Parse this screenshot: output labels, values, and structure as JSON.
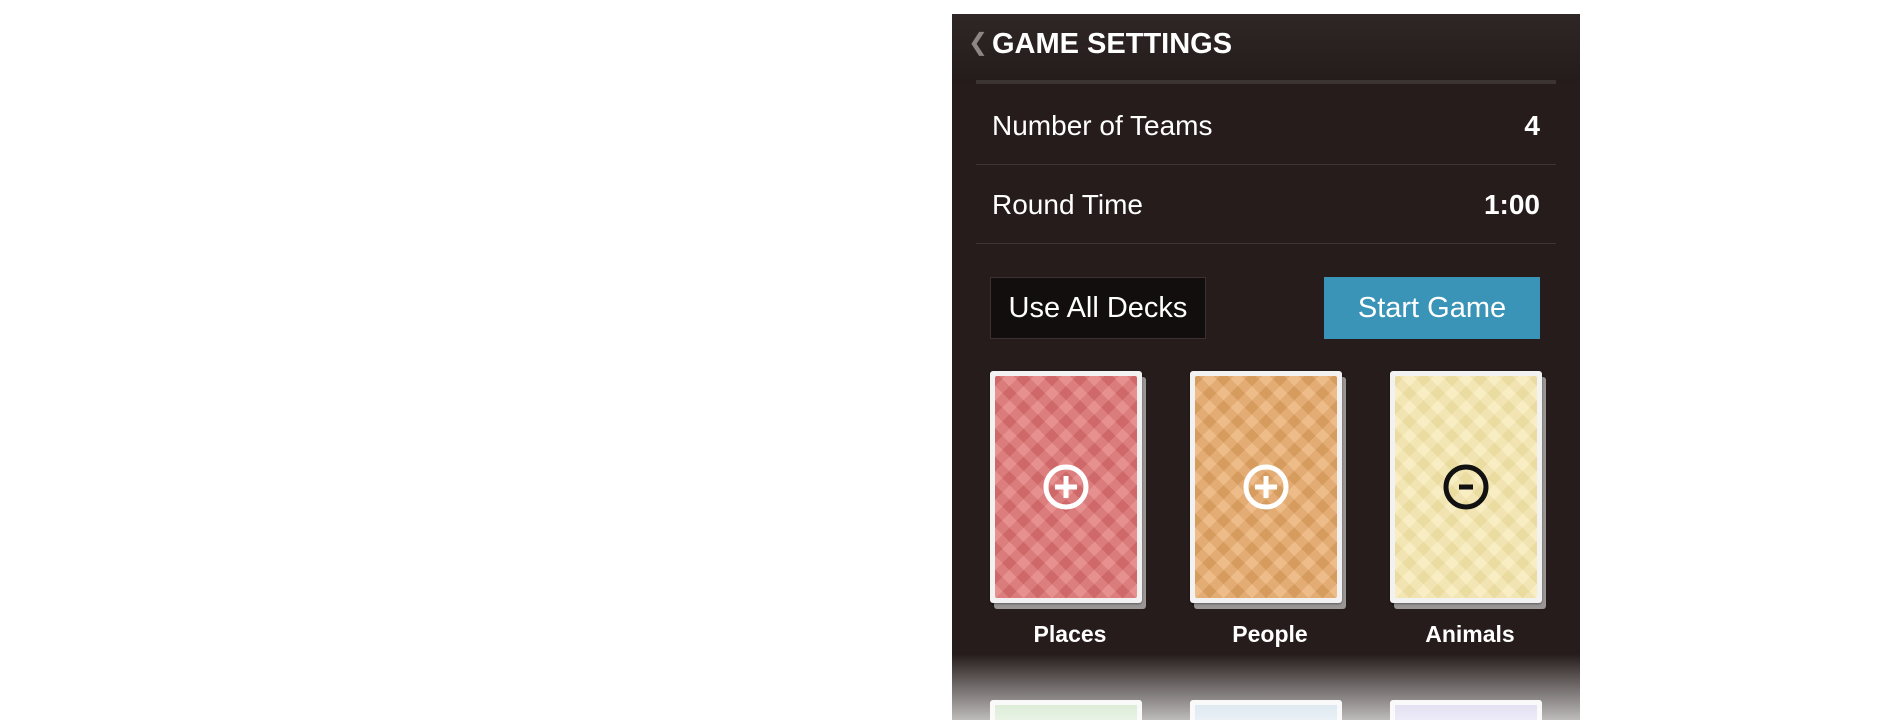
{
  "header": {
    "title": "GAME SETTINGS",
    "back_icon": "back-chevron-icon"
  },
  "settings": {
    "teams": {
      "label": "Number of Teams",
      "value": "4"
    },
    "round_time": {
      "label": "Round Time",
      "value": "1:00"
    }
  },
  "actions": {
    "use_all_label": "Use All Decks",
    "start_label": "Start Game"
  },
  "colors": {
    "accent": "#3a94b7",
    "background": "#251c1b"
  },
  "decks": [
    {
      "name": "Places",
      "color": "#e07070",
      "state_icon": "add-circle-icon"
    },
    {
      "name": "People",
      "color": "#e8a866",
      "state_icon": "add-circle-icon"
    },
    {
      "name": "Animals",
      "color": "#f4e4a6",
      "state_icon": "remove-circle-icon"
    }
  ],
  "more_decks_colors": [
    "#b4d7a8",
    "#b7cfe0",
    "#c4bde6"
  ]
}
